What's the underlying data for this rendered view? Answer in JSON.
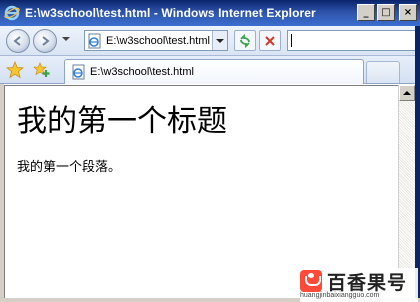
{
  "window": {
    "title": "E:\\w3school\\test.html - Windows Internet Explorer",
    "min_label": "_",
    "max_label": "□",
    "close_label": "×"
  },
  "navbar": {
    "address": "E:\\w3school\\test.html",
    "search_value": ""
  },
  "tab": {
    "label": "E:\\w3school\\test.html"
  },
  "content": {
    "heading": "我的第一个标题",
    "paragraph": "我的第一个段落。"
  },
  "watermark": {
    "brand": "百香果号",
    "url": "huangjinbaixiangguo.com"
  },
  "colors": {
    "titlebar_accent": "#0a246a",
    "watermark_logo": "#ff4a3a"
  },
  "icons": [
    "ie-icon",
    "back-arrow-icon",
    "forward-arrow-icon",
    "page-icon",
    "refresh-icon",
    "stop-icon",
    "favorites-star-icon",
    "add-favorite-icon",
    "scroll-up-arrow-icon"
  ]
}
